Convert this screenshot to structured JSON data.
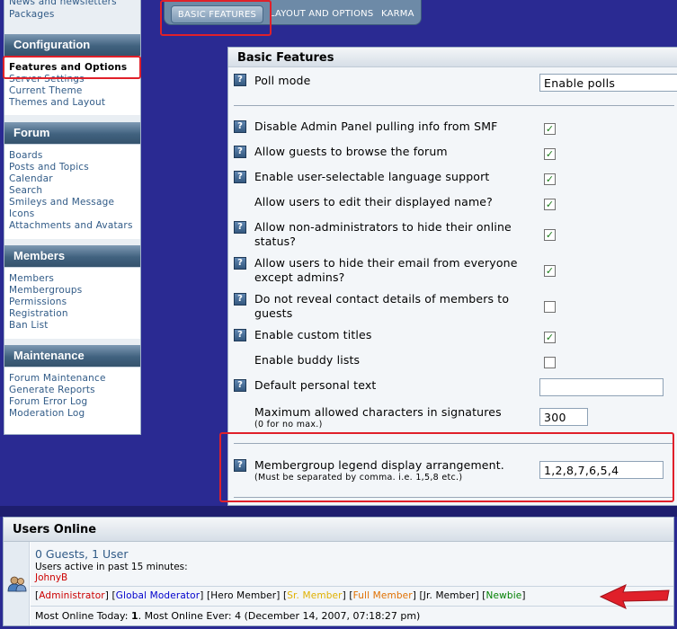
{
  "sidebar": {
    "top_links": [
      "News and newsletters",
      "Packages"
    ],
    "sections": [
      {
        "title": "Configuration",
        "items": [
          "Features and Options",
          "Server Settings",
          "Current Theme",
          "Themes and Layout"
        ]
      },
      {
        "title": "Forum",
        "items": [
          "Boards",
          "Posts and Topics",
          "Calendar",
          "Search",
          "Smileys and Message Icons",
          "Attachments and Avatars"
        ]
      },
      {
        "title": "Members",
        "items": [
          "Members",
          "Membergroups",
          "Permissions",
          "Registration",
          "Ban List"
        ]
      },
      {
        "title": "Maintenance",
        "items": [
          "Forum Maintenance",
          "Generate Reports",
          "Forum Error Log",
          "Moderation Log"
        ]
      }
    ],
    "active_item": "Features and Options"
  },
  "tabs": [
    "BASIC FEATURES",
    "LAYOUT AND OPTIONS",
    "KARMA"
  ],
  "panel": {
    "title": "Basic Features",
    "poll_mode": {
      "label": "Poll mode",
      "value": "Enable polls"
    },
    "options": [
      {
        "label": "Disable Admin Panel pulling info from SMF",
        "checked": true
      },
      {
        "label": "Allow guests to browse the forum",
        "checked": true
      },
      {
        "label": "Enable user-selectable language support",
        "checked": true
      },
      {
        "label": "Allow users to edit their displayed name?",
        "checked": true
      },
      {
        "label": "Allow non-administrators to hide their online status?",
        "checked": true
      },
      {
        "label": "Allow users to hide their email from everyone except admins?",
        "checked": true
      },
      {
        "label": "Do not reveal contact details of members to guests",
        "checked": false
      },
      {
        "label": "Enable custom titles",
        "checked": true
      },
      {
        "label": "Enable buddy lists",
        "checked": false
      }
    ],
    "personal_text": {
      "label": "Default personal text",
      "value": ""
    },
    "signature": {
      "label": "Maximum allowed characters in signatures",
      "note": "(0 for no max.)",
      "value": "300"
    },
    "legend": {
      "label": "Membergroup legend display arrangement.",
      "note": "(Must be separated by comma. i.e. 1,5,8 etc.)",
      "value": "1,2,8,7,6,5,4"
    }
  },
  "users_online": {
    "title": "Users Online",
    "summary": "0 Guests, 1 User",
    "active_label": "Users active in past 15 minutes:",
    "active_user": "JohnyB",
    "legend": [
      {
        "name": "Administrator",
        "color": "#cc0000"
      },
      {
        "name": "Global Moderator",
        "color": "#0000cc"
      },
      {
        "name": "Hero Member",
        "color": "#000000"
      },
      {
        "name": "Sr. Member",
        "color": "#e0b000"
      },
      {
        "name": "Full Member",
        "color": "#e07000"
      },
      {
        "name": "Jr. Member",
        "color": "#000000"
      },
      {
        "name": "Newbie",
        "color": "#008000"
      }
    ],
    "most_online": {
      "today_label": "Most Online Today:",
      "today_value": "1",
      "ever_label": "Most Online Ever:",
      "ever_value": "4 (December 14, 2007, 07:18:27 pm)"
    }
  },
  "colors": {
    "highlight": "#e0202a",
    "arrow": "#e0202a",
    "header_dark": "#41627f",
    "background": "#2a2a92"
  }
}
